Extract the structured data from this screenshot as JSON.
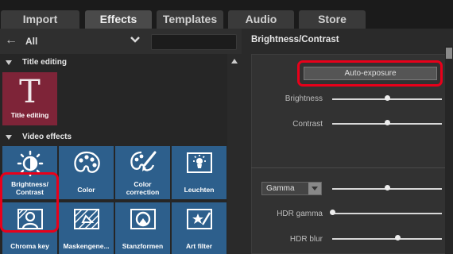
{
  "tabs": [
    {
      "label": "Import",
      "active": false
    },
    {
      "label": "Effects",
      "active": true
    },
    {
      "label": "Templates",
      "active": false
    },
    {
      "label": "Audio",
      "active": false
    },
    {
      "label": "Store",
      "active": false
    }
  ],
  "filter": {
    "label": "All",
    "search_placeholder": ""
  },
  "sections": [
    {
      "title": "Title editing"
    },
    {
      "title": "Video effects"
    }
  ],
  "title_tiles": [
    {
      "label": "Title editing",
      "glyph": "T",
      "icon": "title-t-icon"
    }
  ],
  "effect_tiles": [
    {
      "label": "Brightness/\nContrast",
      "icon": "sun-icon"
    },
    {
      "label": "Color",
      "icon": "palette-icon"
    },
    {
      "label": "Color\ncorrection",
      "icon": "palette-brush-icon"
    },
    {
      "label": "Leuchten",
      "icon": "lamp-icon"
    },
    {
      "label": "Chroma key",
      "icon": "person-screen-icon"
    },
    {
      "label": "Maskengene...",
      "icon": "mask-icon"
    },
    {
      "label": "Stanzformen",
      "icon": "shape-cutout-icon"
    },
    {
      "label": "Art filter",
      "icon": "star-pen-icon"
    }
  ],
  "right_panel": {
    "title": "Brightness/Contrast",
    "auto_exposure_label": "Auto-exposure",
    "params": [
      {
        "label": "Brightness",
        "value": 0.5
      },
      {
        "label": "Contrast",
        "value": 0.5
      }
    ],
    "gamma": {
      "selected": "Gamma",
      "value": 0.5
    },
    "params2": [
      {
        "label": "HDR gamma",
        "value": 0.0
      },
      {
        "label": "HDR blur",
        "value": 0.6
      }
    ]
  },
  "colors": {
    "accent_highlight": "#e8001a",
    "tile_blue": "#2d5f8c",
    "tile_title": "#7e2438"
  }
}
